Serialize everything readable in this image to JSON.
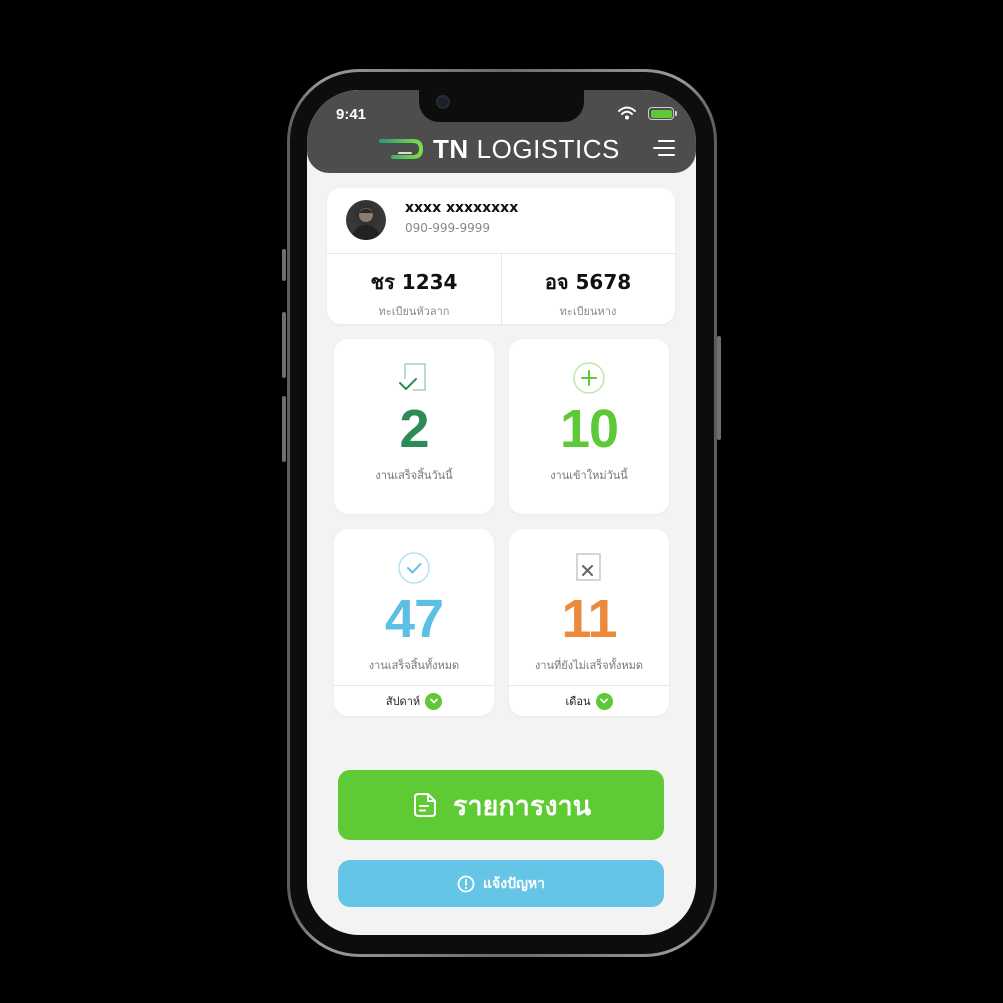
{
  "status_bar": {
    "time": "9:41",
    "wifi_icon": "wifi-icon",
    "battery_icon": "battery-icon",
    "battery_color": "#5ec936"
  },
  "header": {
    "brand_tn": "TN",
    "brand_logistics": "LOGISTICS",
    "logo_icon": "tn-speed-logo",
    "menu_icon": "hamburger-menu-icon",
    "bg_color": "#4d4d4d"
  },
  "profile": {
    "name": "xxxx xxxxxxxx",
    "phone": "090-999-9999",
    "tractor_plate": {
      "value": "ชร 1234",
      "label": "ทะเบียนหัวลาก"
    },
    "trailer_plate": {
      "value": "อจ 5678",
      "label": "ทะเบียนหาง"
    }
  },
  "stats": {
    "completed_today": {
      "value": "2",
      "label": "งานเสร็จสิ้นวันนี้",
      "color": "#2e8b57",
      "icon": "task-check-icon"
    },
    "new_today": {
      "value": "10",
      "label": "งานเข้าใหม่วันนี้",
      "color": "#5ec936",
      "icon": "plus-circle-icon"
    },
    "completed_total": {
      "value": "47",
      "label": "งานเสร็จสิ้นทั้งหมด",
      "color": "#5bc0e3",
      "icon": "check-circle-icon",
      "filter": "สัปดาห์"
    },
    "pending_total": {
      "value": "11",
      "label": "งานที่ยังไม่เสร็จทั้งหมด",
      "color": "#ec8a3c",
      "icon": "task-x-icon",
      "filter": "เดือน"
    }
  },
  "actions": {
    "jobs_label": "รายการงาน",
    "jobs_color": "#5ecb35",
    "jobs_icon": "document-icon",
    "report_label": "แจ้งปัญหา",
    "report_color": "#64c5e6",
    "report_icon": "alert-circle-icon"
  }
}
